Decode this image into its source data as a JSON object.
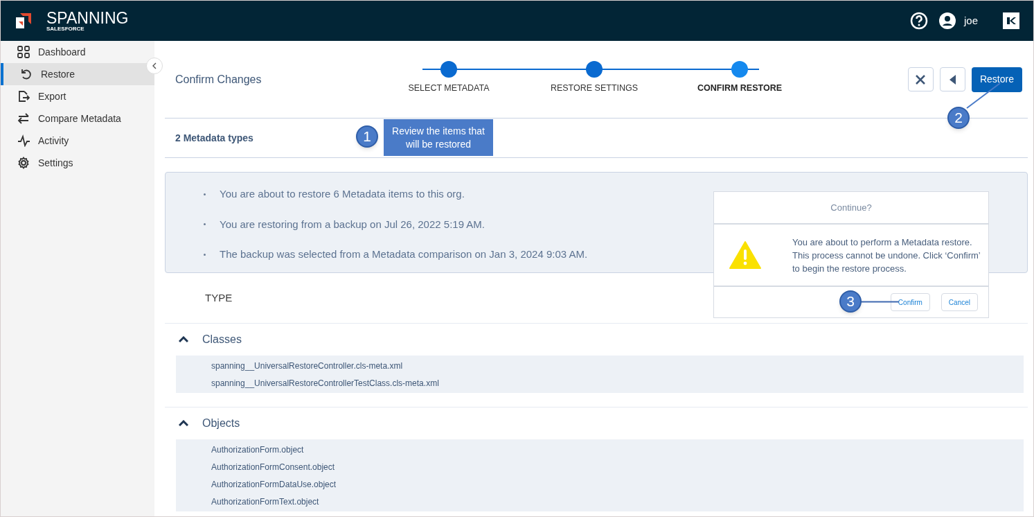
{
  "header": {
    "brand": "SPANNING",
    "sub_brand": "SALESFORCE",
    "user": "joe"
  },
  "sidebar": {
    "items": [
      {
        "label": "Dashboard",
        "selected": false
      },
      {
        "label": "Restore",
        "selected": true
      },
      {
        "label": "Export",
        "selected": false
      },
      {
        "label": "Compare Metadata",
        "selected": false
      },
      {
        "label": "Activity",
        "selected": false
      },
      {
        "label": "Settings",
        "selected": false
      }
    ]
  },
  "page_title": "Confirm Changes",
  "steps": [
    {
      "label": "SELECT METADATA",
      "selected": false
    },
    {
      "label": "RESTORE SETTINGS",
      "selected": false
    },
    {
      "label": "CONFIRM RESTORE",
      "selected": true
    }
  ],
  "restore_button": "Restore",
  "count_label": "2 Metadata types",
  "summary": [
    "You are about to restore 6 Metadata items to this org.",
    "You are restoring from a backup on Jul 26, 2022 5:19 AM.",
    "The backup was selected from a Metadata comparison on Jan 3, 2024 9:03 AM."
  ],
  "type_heading": "TYPE",
  "sections": [
    {
      "title": "Classes",
      "expanded": true,
      "items": [
        "spanning__UniversalRestoreController.cls-meta.xml",
        "spanning__UniversalRestoreControllerTestClass.cls-meta.xml"
      ]
    },
    {
      "title": "Objects",
      "expanded": true,
      "items": [
        "AuthorizationForm.object",
        "AuthorizationFormConsent.object",
        "AuthorizationFormDataUse.object",
        "AuthorizationFormText.object"
      ]
    }
  ],
  "dialog": {
    "title": "Continue?",
    "message": "You are about to perform a Metadata restore. This process cannot be undone. Click ‘Confirm’ to begin the restore process.",
    "buttons": [
      "Confirm",
      "Cancel"
    ]
  },
  "callouts": [
    {
      "number": "1",
      "text": "Review the items that will be restored"
    },
    {
      "number": "2"
    },
    {
      "number": "3"
    }
  ]
}
